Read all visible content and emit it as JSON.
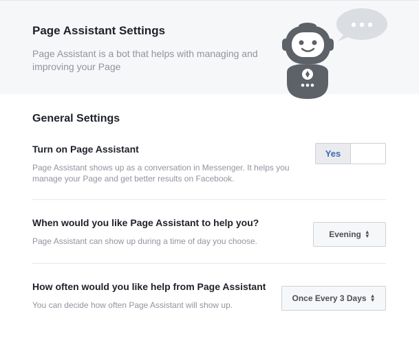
{
  "header": {
    "title": "Page Assistant Settings",
    "description": "Page Assistant is a bot that helps with managing and improving your Page"
  },
  "general": {
    "title": "General Settings",
    "turn_on": {
      "title": "Turn on Page Assistant",
      "description": "Page Assistant shows up as a conversation in Messenger. It helps you manage your Page and get better results on Facebook.",
      "toggle_label": "Yes",
      "enabled": true
    },
    "time": {
      "title": "When would you like Page Assistant to help you?",
      "description": "Page Assistant can show up during a time of day you choose.",
      "selected": "Evening"
    },
    "frequency": {
      "title": "How often would you like help from Page Assistant",
      "description": "You can decide how often Page Assistant will show up.",
      "selected": "Once Every 3 Days"
    }
  },
  "colors": {
    "header_bg": "#f6f7f9",
    "mascot": "#5d6168",
    "accent": "#4267b2"
  },
  "icons": {
    "mascot": "robot-mascot-icon",
    "speech_bubble": "speech-bubble-icon",
    "select_arrows": "up-down-arrows-icon"
  }
}
